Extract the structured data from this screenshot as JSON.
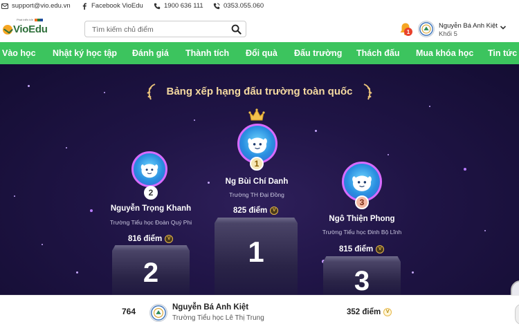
{
  "contact": {
    "email": "support@vio.edu.vn",
    "facebook": "Facebook VioEdu",
    "hotline": "1900 636 111",
    "phone": "0353.055.060"
  },
  "header": {
    "logo_small": "Phát triển bởi",
    "logo_text": "VioEdu",
    "search_placeholder": "Tìm kiếm chủ điểm",
    "notification_count": "1",
    "user_name": "Nguyễn Bá Anh Kiệt",
    "user_grade": "Khối 5"
  },
  "nav": {
    "items": [
      "Vào học",
      "Nhật ký học tập",
      "Đánh giá",
      "Thành tích",
      "Đổi quà",
      "Đấu trường",
      "Thách đấu",
      "Mua khóa học",
      "Tin tức"
    ]
  },
  "leaderboard": {
    "title": "Bảng xếp hạng đấu trường toàn quốc",
    "first": {
      "rank": "1",
      "name": "Ng Bùi Chí Danh",
      "school": "Trường TH Đại Đồng",
      "score": "825 điểm",
      "block": "1"
    },
    "second": {
      "rank": "2",
      "name": "Nguyễn Trọng Khanh",
      "school": "Trường Tiểu học Đoàn Quý Phi",
      "score": "816 điểm",
      "block": "2"
    },
    "third": {
      "rank": "3",
      "name": "Ngô Thiện Phong",
      "school": "Trường Tiểu học Đinh Bộ Lĩnh",
      "score": "815 điểm",
      "block": "3"
    },
    "coin_symbol": "V"
  },
  "my_rank": {
    "rank": "764",
    "name": "Nguyễn Bá Anh Kiệt",
    "school": "Trường Tiểu học Lê Thị Trung",
    "score": "352 điểm"
  },
  "colors": {
    "nav_green": "#3cc45e",
    "stage_dark": "#1f1445",
    "title_gold": "#f4d9a0",
    "avatar_ring": "#d86bff"
  }
}
